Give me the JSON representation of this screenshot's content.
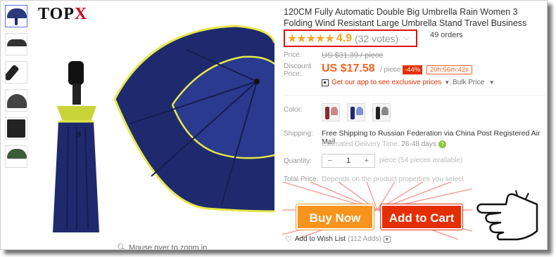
{
  "brand": {
    "name_main": "TOP",
    "name_accent": "X"
  },
  "gallery": {
    "zoom_hint": "Mouse over to zoom in"
  },
  "product": {
    "title": "120CM Fully Automatic Double Big Umbrella Rain Women 3 Folding Wind Resistant Large Umbrella Stand Travel Business Umbrella Men",
    "stars": "★★★★★",
    "rating": "4.9",
    "votes": "(32 votes)",
    "orders": "49 orders"
  },
  "price": {
    "price_label": "Price:",
    "old_price": "US $31.39 / piece",
    "discount_label": "Discount Price:",
    "current_price": "US $17.58",
    "per_piece": "/ piece",
    "discount_badge": "-44%",
    "countdown": "20h:56m:42s",
    "app_promo": "Get our app to see exclusive prices",
    "bulk_price": "Bulk Price"
  },
  "options": {
    "color_label": "Color:",
    "shipping_label": "Shipping:",
    "shipping_text": "Free Shipping to Russian Federation via China Post Registered Air Mail",
    "delivery_label": "Estimated Delivery Time:",
    "delivery_days": "26-48 days",
    "quantity_label": "Quantity:",
    "quantity_value": "1",
    "quantity_minus": "−",
    "quantity_plus": "+",
    "pieces_available": "piece (54 pieces available)",
    "total_label": "Total Price:",
    "total_text": "Depends on the product properties you select"
  },
  "actions": {
    "buy_now": "Buy Now",
    "add_to_cart": "Add to Cart",
    "wishlist": "Add to Wish List",
    "wishlist_adds": "(112 Adds)"
  },
  "colors": {
    "navy": "#1f2a6e",
    "price_orange": "#f26322",
    "buy_orange": "#f7941d",
    "cart_red": "#e62e04",
    "star_gold": "#f5a623",
    "highlight_red": "#dd1111"
  },
  "icons": [
    "qr-code-icon",
    "chevron-down-icon",
    "help-icon",
    "heart-icon",
    "hand-pointer-icon",
    "search-icon"
  ]
}
